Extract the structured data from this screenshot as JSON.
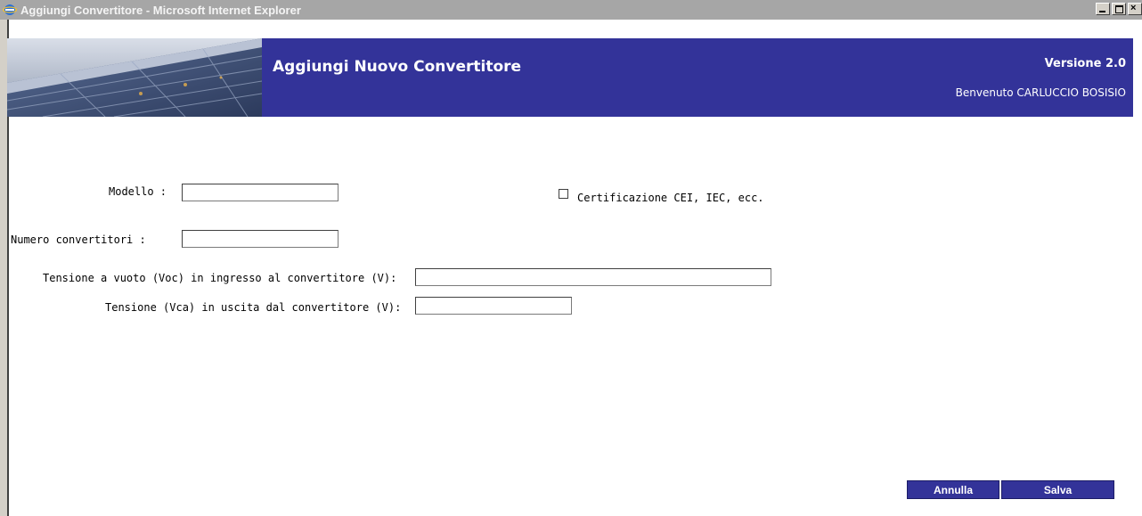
{
  "window": {
    "title": "Aggiungi Convertitore - Microsoft Internet Explorer",
    "controls": [
      "minimize-icon",
      "maximize-icon",
      "close-icon"
    ]
  },
  "header": {
    "title": "Aggiungi Nuovo Convertitore",
    "version": "Versione 2.0",
    "welcome": "Benvenuto CARLUCCIO BOSISIO",
    "color": "#333399"
  },
  "form": {
    "modello": {
      "label": "Modello :",
      "value": ""
    },
    "certificazione": {
      "label": "Certificazione CEI, IEC, ecc.",
      "checked": false
    },
    "numero": {
      "label": "Numero convertitori :",
      "value": ""
    },
    "voc": {
      "label": "Tensione a vuoto (Voc) in ingresso al convertitore (V):",
      "value": ""
    },
    "vca": {
      "label": "Tensione (Vca) in uscita dal convertitore (V):",
      "value": ""
    }
  },
  "actions": {
    "annulla": "Annulla",
    "salva": "Salva"
  }
}
